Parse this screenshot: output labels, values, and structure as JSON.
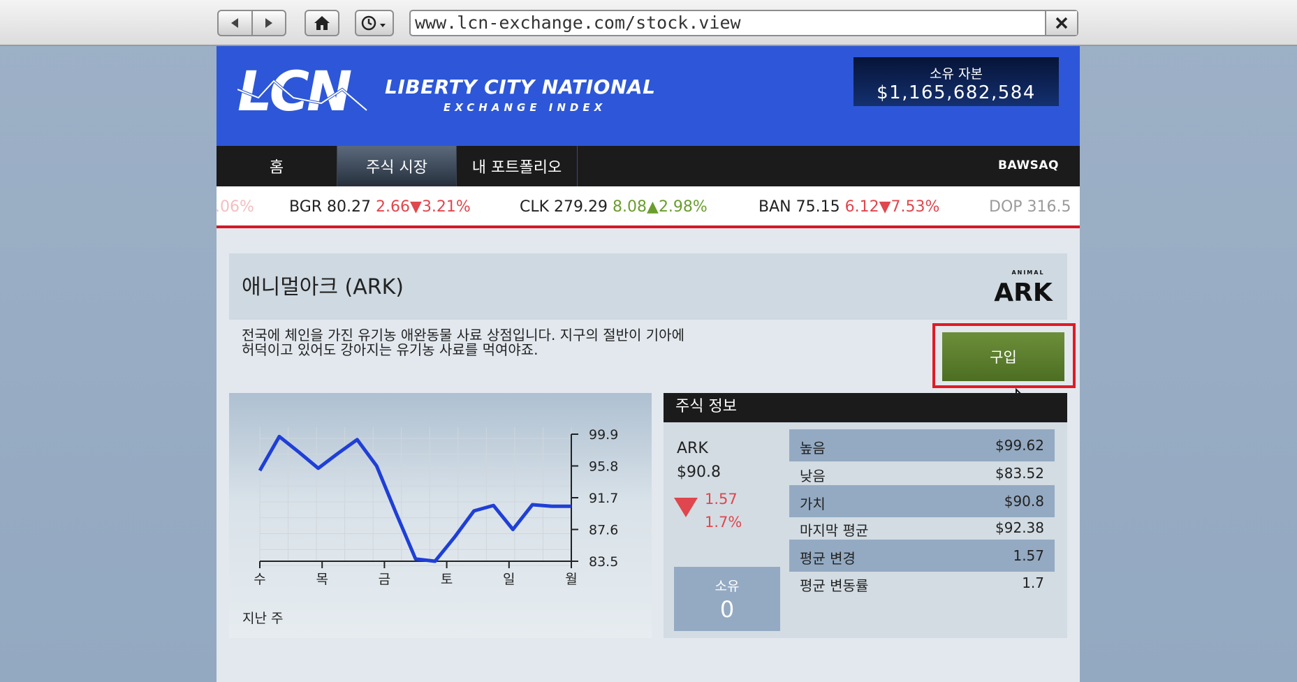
{
  "browser": {
    "url": "www.lcn-exchange.com/stock.view",
    "icons": [
      "back-icon",
      "forward-icon",
      "home-icon",
      "history-icon",
      "close-icon"
    ]
  },
  "header": {
    "logo_text": "LCN",
    "brand_line1": "LIBERTY CITY NATIONAL",
    "brand_line2": "EXCHANGE INDEX",
    "capital_label": "소유 자본",
    "capital_value": "$1,165,682,584",
    "color": "#2d57d8"
  },
  "nav": {
    "tabs": [
      {
        "label": "홈"
      },
      {
        "label": "주식 시장"
      },
      {
        "label": "내 포트폴리오"
      }
    ],
    "active_tab": "주식 시장",
    "brand": "BAWSAQ"
  },
  "ticker": [
    {
      "text": ".06%"
    },
    {
      "symbol": "BGR",
      "price": "80.27",
      "change": "2.66",
      "direction": "down",
      "percent": "3.21%"
    },
    {
      "symbol": "CLK",
      "price": "279.29",
      "change": "8.08",
      "direction": "up",
      "percent": "2.98%"
    },
    {
      "symbol": "BAN",
      "price": "75.15",
      "change": "6.12",
      "direction": "down",
      "percent": "7.53%"
    },
    {
      "text": "DOP 316.5"
    }
  ],
  "stock": {
    "title": "애니멀아크 (ARK)",
    "logo_small": "ANIMAL",
    "logo_big": "ARK",
    "description_line1": "전국에 체인을 가진 유기농 애완동물 사료 상점입니다. 지구의 절반이 기아에",
    "description_line2": "허덕이고 있어도 강아지는 유기농 사료를 먹여야죠.",
    "buy_label": "구입"
  },
  "chart_data": {
    "type": "line",
    "categories": [
      "수",
      "",
      "목",
      "",
      "금",
      "",
      "토",
      "",
      "일",
      "",
      "월"
    ],
    "x_tick_labels": [
      "수",
      "목",
      "금",
      "토",
      "일",
      "월"
    ],
    "y_tick_labels": [
      "99.9",
      "95.8",
      "91.7",
      "87.6",
      "83.5"
    ],
    "ylim": [
      83.5,
      99.9
    ],
    "x": [
      0,
      1,
      2,
      3,
      4,
      5,
      6,
      7,
      8,
      9,
      10,
      11,
      12,
      13,
      14,
      15,
      16
    ],
    "values": [
      95.2,
      99.6,
      97.6,
      95.5,
      97.4,
      99.2,
      95.8,
      89.7,
      83.8,
      83.5,
      86.6,
      90.0,
      90.7,
      87.6,
      90.8,
      90.6,
      90.6
    ],
    "xlabel": "지난 주",
    "line_color": "#1f3fd6",
    "grid": true
  },
  "info": {
    "header": "주식 정보",
    "symbol": "ARK",
    "price": "$90.8",
    "change": "1.57",
    "change_percent": "1.7%",
    "direction": "down",
    "owned_label": "소유",
    "owned_value": "0",
    "rows": [
      {
        "label": "높음",
        "value": "$99.62"
      },
      {
        "label": "낮음",
        "value": "$83.52"
      },
      {
        "label": "가치",
        "value": "$90.8"
      },
      {
        "label": "마지막 평균",
        "value": "$92.38"
      },
      {
        "label": "평균 변경",
        "value": "1.57"
      },
      {
        "label": "평균 변동률",
        "value": "1.7"
      }
    ],
    "down_color": "#e0464d",
    "up_color": "#6a9d2e"
  }
}
